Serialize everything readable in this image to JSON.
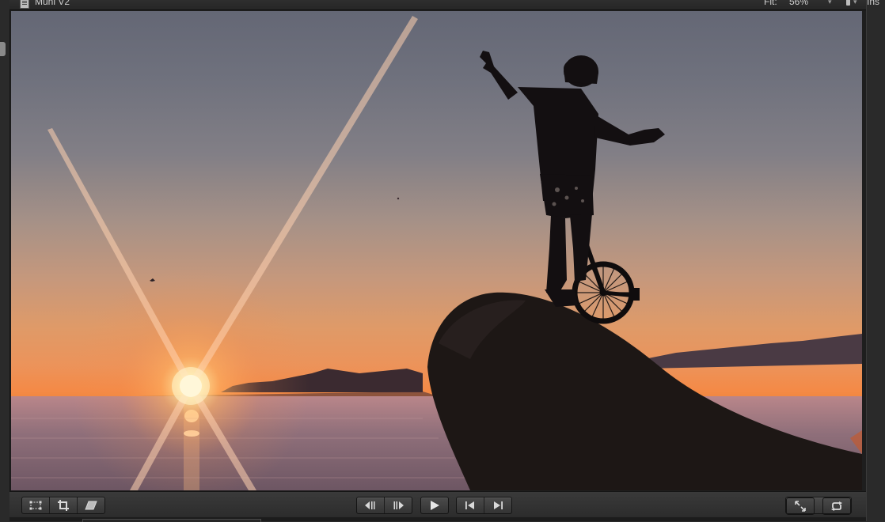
{
  "viewer": {
    "clip_title": "Muni V2",
    "fit_label": "Fit:",
    "zoom_value": "56%"
  },
  "inspector": {
    "tab_label": "Ins"
  },
  "controls": {
    "left_group": [
      "transform",
      "crop",
      "distort"
    ],
    "center_group_1": [
      "step-back",
      "step-forward"
    ],
    "play": "play",
    "center_group_2": [
      "go-to-start",
      "go-to-end"
    ],
    "right_group": [
      "fullscreen",
      "loop"
    ]
  },
  "icons": {
    "clip": "film-clip-icon",
    "transform": "transform-icon",
    "crop": "crop-icon",
    "distort": "distort-icon",
    "step_back": "previous-frame-icon",
    "step_forward": "next-frame-icon",
    "play": "play-icon",
    "go_to_start": "go-to-start-icon",
    "go_to_end": "go-to-end-icon",
    "fullscreen": "fullscreen-icon",
    "loop": "loop-icon"
  },
  "colors": {
    "chrome": "#2b2b2b",
    "button_text": "#d9d9d9",
    "sun": "#fff6d8"
  }
}
